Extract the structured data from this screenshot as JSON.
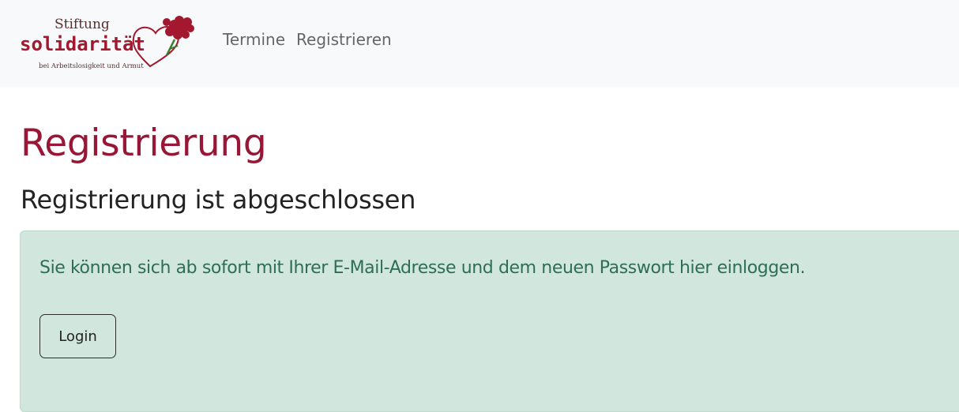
{
  "brand": {
    "logo_line1": "Stiftung",
    "logo_line2": "solidarität",
    "logo_line3": "bei Arbeitslosigkeit und Armut",
    "colors": {
      "red": "#a3182e",
      "green": "#3a7d2c",
      "dark": "#4a2a2a"
    }
  },
  "nav": {
    "items": [
      {
        "label": "Termine"
      },
      {
        "label": "Registrieren"
      }
    ]
  },
  "main": {
    "title": "Registrierung",
    "subtitle": "Registrierung ist abgeschlossen",
    "alert": {
      "message": "Sie können sich ab sofort mit Ihrer E-Mail-Adresse und dem neuen Passwort hier einloggen.",
      "button_label": "Login"
    }
  },
  "colors": {
    "title": "#981736",
    "alert_bg": "#d1e7dd",
    "alert_text": "#2e6e54",
    "navbar_bg": "#f8f9fa"
  }
}
